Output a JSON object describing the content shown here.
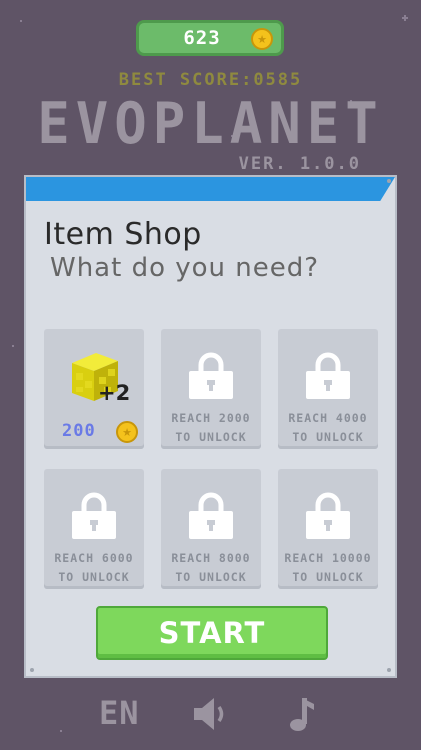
{
  "coins": "623",
  "best_score": "BEST SCORE:0585",
  "game_title": "EVOPLANET",
  "version": "VER. 1.0.0",
  "shop": {
    "title": "Item Shop",
    "subtitle": "What do you need?",
    "items": [
      {
        "type": "cube",
        "bonus": "+2",
        "price": "200"
      },
      {
        "type": "locked",
        "line1": "REACH 2000",
        "line2": "TO UNLOCK"
      },
      {
        "type": "locked",
        "line1": "REACH 4000",
        "line2": "TO UNLOCK"
      },
      {
        "type": "locked",
        "line1": "REACH 6000",
        "line2": "TO UNLOCK"
      },
      {
        "type": "locked",
        "line1": "REACH 8000",
        "line2": "TO UNLOCK"
      },
      {
        "type": "locked",
        "line1": "REACH 10000",
        "line2": "TO UNLOCK"
      }
    ],
    "start_label": "START"
  },
  "footer": {
    "language": "EN",
    "sound_icon": "speaker-icon",
    "music_icon": "music-note-icon"
  },
  "colors": {
    "background": "#5f5466",
    "accent_blue": "#2b95e0",
    "start_green": "#7ed85c",
    "coin_gold": "#f4c21c"
  }
}
